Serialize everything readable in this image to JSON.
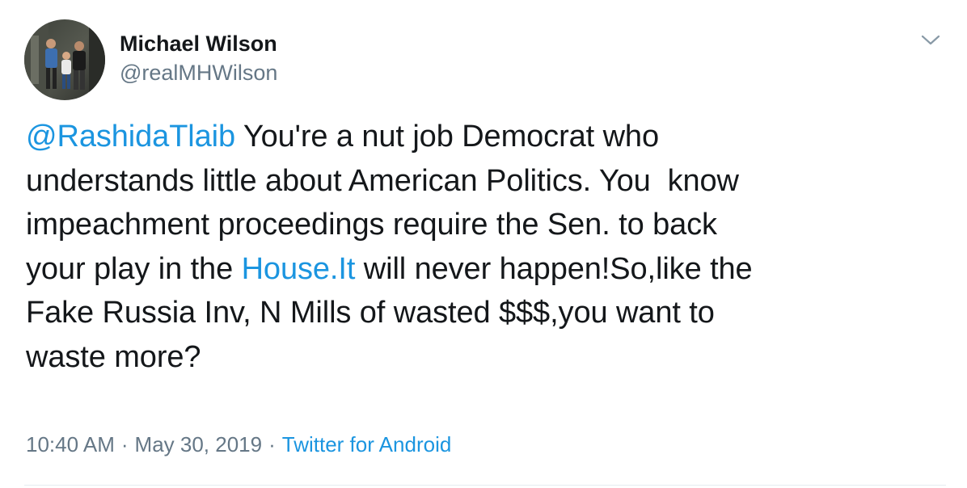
{
  "tweet": {
    "author": {
      "display_name": "Michael Wilson",
      "handle": "@realMHWilson"
    },
    "menu_icon": "chevron-down-icon",
    "text_parts": {
      "mention": "@RashidaTlaib",
      "part1": " You're a nut job Democrat who\nunderstands little about American Politics. You  know\nimpeachment proceedings require the Sen. to back\nyour play in the ",
      "link": "House.It",
      "part2": " will never happen!So,like the\nFake Russia Inv, N Mills of wasted $$$,you want to\nwaste more?"
    },
    "time": "10:40 AM",
    "separator": "·",
    "date": "May 30, 2019",
    "source": "Twitter for Android"
  },
  "colors": {
    "text": "#14171a",
    "secondary": "#657786",
    "link": "#1b95e0",
    "divider": "#e6ecf0"
  }
}
